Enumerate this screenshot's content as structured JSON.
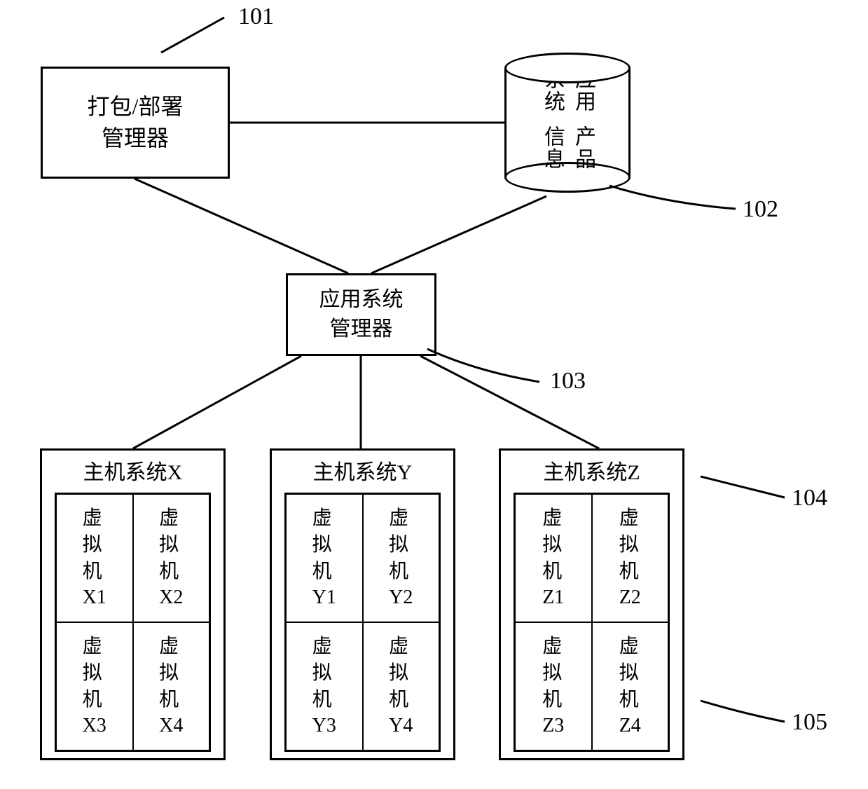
{
  "nodes": {
    "package_manager": {
      "line1": "打包/部署",
      "line2": "管理器"
    },
    "product_info": {
      "col1": "应用系统",
      "col2": "产品信息"
    },
    "app_manager": {
      "line1": "应用系统",
      "line2": "管理器"
    }
  },
  "hosts": [
    {
      "title": "主机系统X",
      "vms": [
        "虚拟机X1",
        "虚拟机X2",
        "虚拟机X3",
        "虚拟机X4"
      ]
    },
    {
      "title": "主机系统Y",
      "vms": [
        "虚拟机Y1",
        "虚拟机Y2",
        "虚拟机Y3",
        "虚拟机Y4"
      ]
    },
    {
      "title": "主机系统Z",
      "vms": [
        "虚拟机Z1",
        "虚拟机Z2",
        "虚拟机Z3",
        "虚拟机Z4"
      ]
    }
  ],
  "callouts": {
    "c101": "101",
    "c102": "102",
    "c103": "103",
    "c104": "104",
    "c105": "105"
  }
}
